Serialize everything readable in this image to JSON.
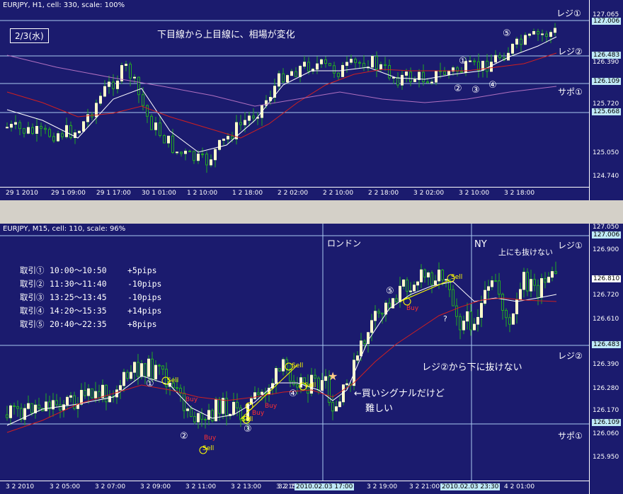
{
  "top": {
    "header": "EURJPY, H1, cell: 330, scale: 100%",
    "date_box": "2/3(水)",
    "title_note": "下目線から上目線に、相場が変化",
    "line_labels": {
      "res1": "レジ①",
      "res2": "レジ②",
      "sup1": "サポ①"
    },
    "markers": [
      "①",
      "②",
      "③",
      "④",
      "⑤"
    ],
    "price_labels": [
      "127.065",
      "127.006",
      "126.483",
      "126.390",
      "126.109",
      "125.720",
      "125.668",
      "125.050",
      "124.740"
    ],
    "time_labels": [
      "29 1 2010",
      "29 1 09:00",
      "29 1 17:00",
      "30 1 01:00",
      "1 2 10:00",
      "1 2 18:00",
      "2 2 02:00",
      "2 2 10:00",
      "2 2 18:00",
      "3 2 02:00",
      "3 2 10:00",
      "3 2 18:00"
    ]
  },
  "bottom": {
    "header": "EURJPY, M15, cell: 110, scale: 96%",
    "london": "ロンドン",
    "ny": "NY",
    "line_labels": {
      "res1": "レジ①",
      "res2": "レジ②",
      "sup1": "サポ①"
    },
    "trades": [
      {
        "name": "取引①",
        "time": "10:00～10:50",
        "pips": "+5pips"
      },
      {
        "name": "取引②",
        "time": "11:30～11:40",
        "pips": "-10pips"
      },
      {
        "name": "取引③",
        "time": "13:25～13:45",
        "pips": "-10pips"
      },
      {
        "name": "取引④",
        "time": "14:20～15:35",
        "pips": "+14pips"
      },
      {
        "name": "取引⑤",
        "time": "20:40～22:35",
        "pips": "+8pips"
      }
    ],
    "notes": {
      "buy_signal_1": "←買いシグナルだけど",
      "buy_signal_2": "難しい",
      "no_break_down": "レジ②から下に抜けない",
      "no_break_up": "上にも抜けない",
      "question": "?"
    },
    "signals": {
      "sell": "Sell",
      "buy": "Buy"
    },
    "markers": [
      "①",
      "②",
      "③",
      "④",
      "⑤"
    ],
    "price_labels": [
      "127.050",
      "127.006",
      "126.900",
      "126.810",
      "126.720",
      "126.610",
      "126.483",
      "126.390",
      "126.280",
      "126.170",
      "126.109",
      "126.060",
      "125.950"
    ],
    "time_labels": [
      "3 2 2010",
      "3 2 05:00",
      "3 2 07:00",
      "3 2 09:00",
      "3 2 11:00",
      "3 2 13:00",
      "3 2 15:00",
      "3 2 1",
      "2010.02.03 17:00",
      "3 2 19:00",
      "3 2 21:00",
      "2010.02.03 23:30",
      "4 2 01:00"
    ]
  },
  "colors": {
    "background": "#1b1b6e",
    "bull": "#ffffcc",
    "bear": "#22aa22",
    "ma_fast": "#ffffff",
    "ma_mid": "#d02020",
    "ma_slow": "#b070c0",
    "hline": "#a8c8f0",
    "highlight": "#bfe8f6",
    "sell": "#ffff00",
    "buy": "#ff2020"
  }
}
